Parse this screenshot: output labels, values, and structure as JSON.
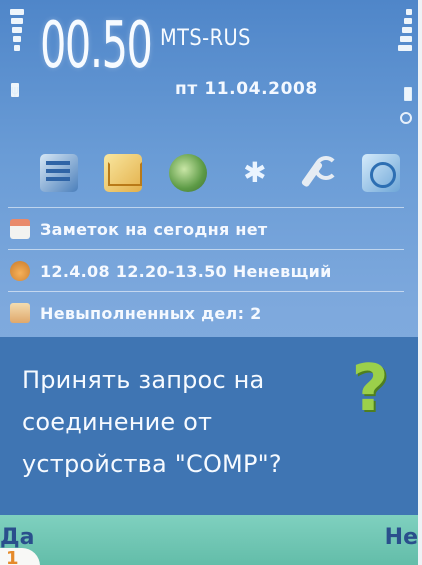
{
  "status": {
    "time": "00.50",
    "operator": "MTS-RUS",
    "date": "пт 11.04.2008"
  },
  "apps": [
    {
      "name": "contacts-icon"
    },
    {
      "name": "messages-icon"
    },
    {
      "name": "web-icon"
    },
    {
      "name": "bluetooth-icon"
    },
    {
      "name": "tools-icon"
    },
    {
      "name": "gallery-icon"
    }
  ],
  "notes": [
    {
      "icon": "calendar-icon",
      "text": "Заметок на сегодня нет"
    },
    {
      "icon": "meeting-icon",
      "text": "12.4.08 12.20-13.50 Неневщий"
    },
    {
      "icon": "todo-icon",
      "text": "Невыполненных дел: 2"
    }
  ],
  "dialog": {
    "line1": "Принять запрос на",
    "line2": "соединение от",
    "line3": "устройства \"COMP\"?",
    "icon": "question-icon"
  },
  "softkeys": {
    "left": "Да",
    "right": "Не"
  },
  "corner_marker": "1",
  "colors": {
    "background": "#6a9cd6",
    "dialog": "#3f75b3",
    "softkeys": "#7fd0bf",
    "softkey_text": "#2a4f8c",
    "question_mark": "#9bd04a"
  }
}
